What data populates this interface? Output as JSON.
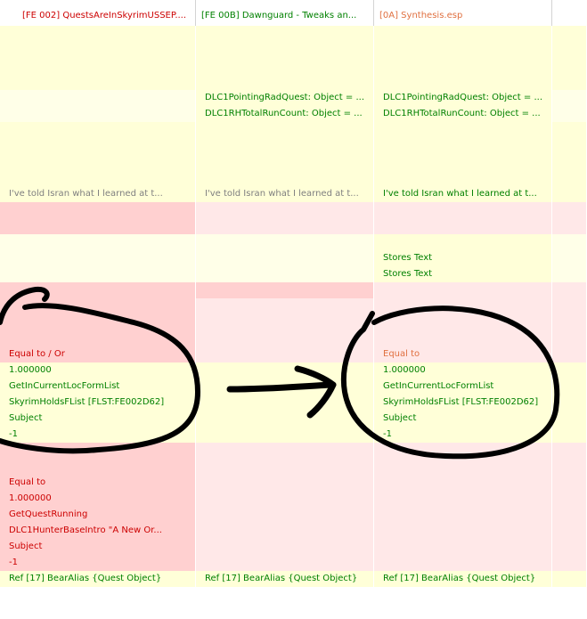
{
  "colors": {
    "yellow": "#ffffd8",
    "yellow_light": "#ffffe8",
    "red": "#ffd0d0",
    "red_light": "#ffe8e8",
    "white": "#ffffff",
    "text_green": "#008000",
    "text_red": "#cc0000",
    "text_gray": "#808080",
    "text_orange": "#e07040"
  },
  "headers": [
    {
      "label": "[FE 002] QuestsAreInSkyrimUSSEP....",
      "color": "#cc0000"
    },
    {
      "label": "[FE 00B] Dawnguard - Tweaks an...",
      "color": "#008000"
    },
    {
      "label": "[0A] Synthesis.esp",
      "color": "#e07040"
    },
    {
      "label": "",
      "color": "#000000"
    }
  ],
  "rows": [
    {
      "bg": [
        "yellow",
        "yellow",
        "yellow",
        "yellow"
      ],
      "cells": [
        {
          "t": "",
          "c": ""
        },
        {
          "t": "",
          "c": ""
        },
        {
          "t": "",
          "c": ""
        },
        {
          "t": "",
          "c": ""
        }
      ]
    },
    {
      "bg": [
        "yellow",
        "yellow",
        "yellow",
        "yellow"
      ],
      "cells": [
        {
          "t": "",
          "c": ""
        },
        {
          "t": "",
          "c": ""
        },
        {
          "t": "",
          "c": ""
        },
        {
          "t": "",
          "c": ""
        }
      ]
    },
    {
      "bg": [
        "yellow",
        "yellow",
        "yellow",
        "yellow"
      ],
      "cells": [
        {
          "t": "",
          "c": ""
        },
        {
          "t": "",
          "c": ""
        },
        {
          "t": "",
          "c": ""
        },
        {
          "t": "",
          "c": ""
        }
      ]
    },
    {
      "bg": [
        "yellow",
        "yellow",
        "yellow",
        "yellow"
      ],
      "cells": [
        {
          "t": "",
          "c": ""
        },
        {
          "t": "",
          "c": ""
        },
        {
          "t": "",
          "c": ""
        },
        {
          "t": "",
          "c": ""
        }
      ]
    },
    {
      "bg": [
        "yellow_light",
        "yellow",
        "yellow",
        "yellow_light"
      ],
      "cells": [
        {
          "t": "",
          "c": ""
        },
        {
          "t": "DLC1PointingRadQuest: Object = ...",
          "c": "text_green"
        },
        {
          "t": "DLC1PointingRadQuest: Object = ...",
          "c": "text_green"
        },
        {
          "t": "",
          "c": ""
        }
      ]
    },
    {
      "bg": [
        "yellow_light",
        "yellow",
        "yellow",
        "yellow_light"
      ],
      "dashed": true,
      "cells": [
        {
          "t": "",
          "c": ""
        },
        {
          "t": "DLC1RHTotalRunCount: Object = ...",
          "c": "text_green"
        },
        {
          "t": "DLC1RHTotalRunCount: Object = ...",
          "c": "text_green"
        },
        {
          "t": "",
          "c": ""
        }
      ]
    },
    {
      "bg": [
        "yellow",
        "yellow",
        "yellow",
        "yellow"
      ],
      "cells": [
        {
          "t": "",
          "c": ""
        },
        {
          "t": "",
          "c": ""
        },
        {
          "t": "",
          "c": ""
        },
        {
          "t": "",
          "c": ""
        }
      ]
    },
    {
      "bg": [
        "yellow",
        "yellow",
        "yellow",
        "yellow"
      ],
      "cells": [
        {
          "t": "",
          "c": ""
        },
        {
          "t": "",
          "c": ""
        },
        {
          "t": "",
          "c": ""
        },
        {
          "t": "",
          "c": ""
        }
      ]
    },
    {
      "bg": [
        "yellow",
        "yellow",
        "yellow",
        "yellow"
      ],
      "cells": [
        {
          "t": "",
          "c": ""
        },
        {
          "t": "",
          "c": ""
        },
        {
          "t": "",
          "c": ""
        },
        {
          "t": "",
          "c": ""
        }
      ]
    },
    {
      "bg": [
        "yellow",
        "yellow",
        "yellow",
        "yellow"
      ],
      "cells": [
        {
          "t": "",
          "c": ""
        },
        {
          "t": "",
          "c": ""
        },
        {
          "t": "",
          "c": ""
        },
        {
          "t": "",
          "c": ""
        }
      ]
    },
    {
      "bg": [
        "yellow",
        "yellow",
        "yellow",
        "yellow"
      ],
      "cells": [
        {
          "t": "I've told Isran what I learned at t...",
          "c": "text_gray"
        },
        {
          "t": "I've told Isran what I learned at t...",
          "c": "text_gray"
        },
        {
          "t": "I've told Isran what I learned at t...",
          "c": "text_green"
        },
        {
          "t": "",
          "c": ""
        }
      ]
    },
    {
      "bg": [
        "red",
        "red_light",
        "red_light",
        "red_light"
      ],
      "cells": [
        {
          "t": "",
          "c": ""
        },
        {
          "t": "",
          "c": ""
        },
        {
          "t": "",
          "c": ""
        },
        {
          "t": "",
          "c": ""
        }
      ]
    },
    {
      "bg": [
        "red",
        "red_light",
        "red_light",
        "red_light"
      ],
      "cells": [
        {
          "t": "",
          "c": ""
        },
        {
          "t": "",
          "c": ""
        },
        {
          "t": "",
          "c": ""
        },
        {
          "t": "",
          "c": ""
        }
      ]
    },
    {
      "bg": [
        "yellow_light",
        "yellow_light",
        "yellow",
        "yellow_light"
      ],
      "cells": [
        {
          "t": "",
          "c": ""
        },
        {
          "t": "",
          "c": ""
        },
        {
          "t": "",
          "c": ""
        },
        {
          "t": "",
          "c": ""
        }
      ]
    },
    {
      "bg": [
        "yellow_light",
        "yellow_light",
        "yellow",
        "yellow_light"
      ],
      "cells": [
        {
          "t": "",
          "c": ""
        },
        {
          "t": "",
          "c": ""
        },
        {
          "t": "Stores Text",
          "c": "text_green"
        },
        {
          "t": "",
          "c": ""
        }
      ]
    },
    {
      "bg": [
        "yellow_light",
        "yellow_light",
        "yellow",
        "yellow_light"
      ],
      "cells": [
        {
          "t": "",
          "c": ""
        },
        {
          "t": "",
          "c": ""
        },
        {
          "t": "Stores Text",
          "c": "text_green"
        },
        {
          "t": "",
          "c": ""
        }
      ]
    },
    {
      "bg": [
        "red",
        "red",
        "red_light",
        "red_light"
      ],
      "cells": [
        {
          "t": "",
          "c": ""
        },
        {
          "t": "",
          "c": ""
        },
        {
          "t": "",
          "c": ""
        },
        {
          "t": "",
          "c": ""
        }
      ]
    },
    {
      "bg": [
        "red",
        "red_light",
        "red_light",
        "red_light"
      ],
      "cells": [
        {
          "t": "",
          "c": ""
        },
        {
          "t": "",
          "c": ""
        },
        {
          "t": "",
          "c": ""
        },
        {
          "t": "",
          "c": ""
        }
      ]
    },
    {
      "bg": [
        "red",
        "red_light",
        "red_light",
        "red_light"
      ],
      "cells": [
        {
          "t": "",
          "c": ""
        },
        {
          "t": "",
          "c": ""
        },
        {
          "t": "",
          "c": ""
        },
        {
          "t": "",
          "c": ""
        }
      ]
    },
    {
      "bg": [
        "red",
        "red_light",
        "red_light",
        "red_light"
      ],
      "cells": [
        {
          "t": "",
          "c": ""
        },
        {
          "t": "",
          "c": ""
        },
        {
          "t": "",
          "c": ""
        },
        {
          "t": "",
          "c": ""
        }
      ]
    },
    {
      "bg": [
        "red",
        "red_light",
        "red_light",
        "red_light"
      ],
      "cells": [
        {
          "t": "Equal to / Or",
          "c": "text_red"
        },
        {
          "t": "",
          "c": ""
        },
        {
          "t": "Equal to",
          "c": "text_orange"
        },
        {
          "t": "",
          "c": ""
        }
      ]
    },
    {
      "bg": [
        "yellow",
        "yellow",
        "yellow",
        "yellow"
      ],
      "cells": [
        {
          "t": "1.000000",
          "c": "text_green"
        },
        {
          "t": "",
          "c": ""
        },
        {
          "t": "1.000000",
          "c": "text_green"
        },
        {
          "t": "",
          "c": ""
        }
      ]
    },
    {
      "bg": [
        "yellow",
        "yellow",
        "yellow",
        "yellow"
      ],
      "cells": [
        {
          "t": "GetInCurrentLocFormList",
          "c": "text_green"
        },
        {
          "t": "",
          "c": ""
        },
        {
          "t": "GetInCurrentLocFormList",
          "c": "text_green"
        },
        {
          "t": "",
          "c": ""
        }
      ]
    },
    {
      "bg": [
        "yellow",
        "yellow",
        "yellow",
        "yellow"
      ],
      "cells": [
        {
          "t": "SkyrimHoldsFList [FLST:FE002D62]",
          "c": "text_green"
        },
        {
          "t": "",
          "c": ""
        },
        {
          "t": "SkyrimHoldsFList [FLST:FE002D62]",
          "c": "text_green"
        },
        {
          "t": "",
          "c": ""
        }
      ]
    },
    {
      "bg": [
        "yellow",
        "yellow",
        "yellow",
        "yellow"
      ],
      "cells": [
        {
          "t": "Subject",
          "c": "text_green"
        },
        {
          "t": "",
          "c": ""
        },
        {
          "t": "Subject",
          "c": "text_green"
        },
        {
          "t": "",
          "c": ""
        }
      ]
    },
    {
      "bg": [
        "yellow",
        "yellow",
        "yellow",
        "yellow"
      ],
      "cells": [
        {
          "t": "-1",
          "c": "text_green"
        },
        {
          "t": "",
          "c": ""
        },
        {
          "t": "-1",
          "c": "text_green"
        },
        {
          "t": "",
          "c": ""
        }
      ]
    },
    {
      "bg": [
        "red",
        "red_light",
        "red_light",
        "red_light"
      ],
      "cells": [
        {
          "t": "",
          "c": ""
        },
        {
          "t": "",
          "c": ""
        },
        {
          "t": "",
          "c": ""
        },
        {
          "t": "",
          "c": ""
        }
      ]
    },
    {
      "bg": [
        "red",
        "red_light",
        "red_light",
        "red_light"
      ],
      "cells": [
        {
          "t": "",
          "c": ""
        },
        {
          "t": "",
          "c": ""
        },
        {
          "t": "",
          "c": ""
        },
        {
          "t": "",
          "c": ""
        }
      ]
    },
    {
      "bg": [
        "red",
        "red_light",
        "red_light",
        "red_light"
      ],
      "cells": [
        {
          "t": "Equal to",
          "c": "text_red"
        },
        {
          "t": "",
          "c": ""
        },
        {
          "t": "",
          "c": ""
        },
        {
          "t": "",
          "c": ""
        }
      ]
    },
    {
      "bg": [
        "red",
        "red_light",
        "red_light",
        "red_light"
      ],
      "cells": [
        {
          "t": "1.000000",
          "c": "text_red"
        },
        {
          "t": "",
          "c": ""
        },
        {
          "t": "",
          "c": ""
        },
        {
          "t": "",
          "c": ""
        }
      ]
    },
    {
      "bg": [
        "red",
        "red_light",
        "red_light",
        "red_light"
      ],
      "cells": [
        {
          "t": "GetQuestRunning",
          "c": "text_red"
        },
        {
          "t": "",
          "c": ""
        },
        {
          "t": "",
          "c": ""
        },
        {
          "t": "",
          "c": ""
        }
      ]
    },
    {
      "bg": [
        "red",
        "red_light",
        "red_light",
        "red_light"
      ],
      "cells": [
        {
          "t": "DLC1HunterBaseIntro \"A New Or...",
          "c": "text_red"
        },
        {
          "t": "",
          "c": ""
        },
        {
          "t": "",
          "c": ""
        },
        {
          "t": "",
          "c": ""
        }
      ]
    },
    {
      "bg": [
        "red",
        "red_light",
        "red_light",
        "red_light"
      ],
      "cells": [
        {
          "t": "Subject",
          "c": "text_red"
        },
        {
          "t": "",
          "c": ""
        },
        {
          "t": "",
          "c": ""
        },
        {
          "t": "",
          "c": ""
        }
      ]
    },
    {
      "bg": [
        "red",
        "red_light",
        "red_light",
        "red_light"
      ],
      "cells": [
        {
          "t": "-1",
          "c": "text_red"
        },
        {
          "t": "",
          "c": ""
        },
        {
          "t": "",
          "c": ""
        },
        {
          "t": "",
          "c": ""
        }
      ]
    },
    {
      "bg": [
        "yellow",
        "yellow",
        "yellow",
        "yellow"
      ],
      "cells": [
        {
          "t": "Ref [17] BearAlias {Quest Object}",
          "c": "text_green"
        },
        {
          "t": "Ref [17] BearAlias {Quest Object}",
          "c": "text_green"
        },
        {
          "t": "Ref [17] BearAlias {Quest Object}",
          "c": "text_green"
        },
        {
          "t": "",
          "c": ""
        }
      ]
    },
    {
      "bg": [
        "white",
        "white",
        "white",
        "white"
      ],
      "cells": [
        {
          "t": "",
          "c": ""
        },
        {
          "t": "",
          "c": ""
        },
        {
          "t": "",
          "c": ""
        },
        {
          "t": "",
          "c": ""
        }
      ]
    },
    {
      "bg": [
        "white",
        "white",
        "white",
        "white"
      ],
      "cells": [
        {
          "t": "",
          "c": ""
        },
        {
          "t": "",
          "c": ""
        },
        {
          "t": "",
          "c": ""
        },
        {
          "t": "",
          "c": ""
        }
      ]
    }
  ]
}
